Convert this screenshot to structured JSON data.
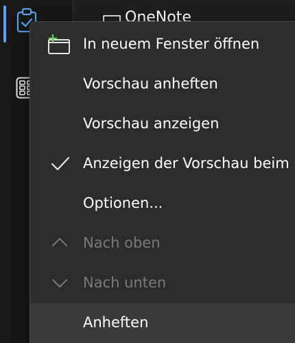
{
  "background": {
    "window_title": "OneNote"
  },
  "nav_rail": {
    "items": [
      {
        "icon": "clipboard-check-icon",
        "selected": true
      },
      {
        "icon": "apps-grid-icon",
        "selected": false
      }
    ],
    "accent_color": "#5aa0f0"
  },
  "context_menu": {
    "items": [
      {
        "label": "In neuem Fenster öffnen",
        "icon": "new-window-icon",
        "enabled": true
      },
      {
        "label": "Vorschau anheften",
        "icon": "",
        "enabled": true
      },
      {
        "label": "Vorschau anzeigen",
        "icon": "",
        "enabled": true
      },
      {
        "label": "Anzeigen der Vorschau beim",
        "icon": "checkmark-icon",
        "enabled": true,
        "checked": true
      },
      {
        "label": "Optionen...",
        "icon": "",
        "enabled": true
      },
      {
        "label": "Nach oben",
        "icon": "chevron-up-icon",
        "enabled": false
      },
      {
        "label": "Nach unten",
        "icon": "chevron-down-icon",
        "enabled": false
      },
      {
        "label": "Anheften",
        "icon": "",
        "enabled": true,
        "hovered": true
      }
    ]
  },
  "colors": {
    "menu_bg": "#2c2c2c",
    "menu_hover": "#3a3a3a",
    "text": "#ffffff",
    "text_disabled": "#7a7a7a",
    "icon_accent": "#6ccb5f"
  }
}
